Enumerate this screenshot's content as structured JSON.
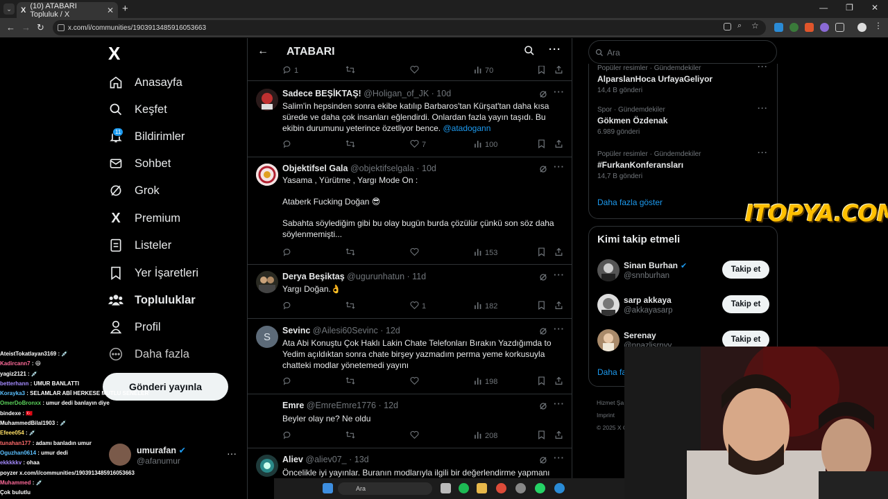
{
  "browser": {
    "tab_title": "(10) ATABARI Topluluk / X",
    "tab_logo": "X",
    "url": "x.com/i/communities/1903913485916053663",
    "new_tab_label": "+",
    "window_controls": [
      "—",
      "❐",
      "✕"
    ]
  },
  "nav": {
    "logo": "X",
    "items": [
      {
        "label": "Anasayfa",
        "icon": "home-icon"
      },
      {
        "label": "Keşfet",
        "icon": "search-icon"
      },
      {
        "label": "Bildirimler",
        "icon": "bell-icon"
      },
      {
        "label": "Sohbet",
        "icon": "mail-icon"
      },
      {
        "label": "Grok",
        "icon": "grok-icon"
      },
      {
        "label": "Premium",
        "icon": "x-icon"
      },
      {
        "label": "Listeler",
        "icon": "list-icon"
      },
      {
        "label": "Yer İşaretleri",
        "icon": "bookmark-icon"
      },
      {
        "label": "Topluluklar",
        "icon": "communities-icon"
      },
      {
        "label": "Profil",
        "icon": "profile-icon"
      },
      {
        "label": "Daha fazla",
        "icon": "more-circle-icon"
      }
    ],
    "notification_badge": "11",
    "post_button": "Gönderi yayınla",
    "account": {
      "name": "umurafan",
      "handle": "@afanumur",
      "more": "···"
    }
  },
  "chat": [
    {
      "user": "AteistTokatlayan3169",
      "color": "#ffffff",
      "msg": ": 💉"
    },
    {
      "user": "Kadircann7",
      "color": "#ff6b9a",
      "msg": ": 😆"
    },
    {
      "user": "yagiz2121",
      "color": "#ffffff",
      "msg": ": 💉"
    },
    {
      "user": "betterhann",
      "color": "#a58bff",
      "msg": ": UMUR BANLATTI"
    },
    {
      "user": "Korayka3",
      "color": "#5bc0ff",
      "msg": ": SELAMLAR ABİ HERKESE MUTLU SENELER"
    },
    {
      "user": "OmerDoBronxx",
      "color": "#5bd35b",
      "msg": ": umur dedi banlayın diye"
    },
    {
      "user": "bindexe",
      "color": "#ffffff",
      "msg": ": 🇹🇷"
    },
    {
      "user": "MuhammedBilal1903",
      "color": "#ffffff",
      "msg": ": 💉"
    },
    {
      "user": "Efeee054",
      "color": "#ffe066",
      "msg": ": 💉"
    },
    {
      "user": "tunahan177",
      "color": "#ff6b6b",
      "msg": ": adamı banladın umur"
    },
    {
      "user": "Oguzhan0614",
      "color": "#5bc0ff",
      "msg": ": umur dedi"
    },
    {
      "user": "ekkkkkv",
      "color": "#a58bff",
      "msg": ": ohaa"
    },
    {
      "user": "poyzer",
      "color": "#ffffff",
      "msg": "x.com/i/communities/1903913485916053663"
    },
    {
      "user": "Muhammed",
      "color": "#ff6b9a",
      "msg": ": 💉"
    },
    {
      "user": "",
      "color": "#cccccc",
      "msg": "Çok bulutlu"
    }
  ],
  "main": {
    "title": "ATABARI",
    "tweets": [
      {
        "name": "",
        "handle": "",
        "time": "",
        "text": "",
        "stats": {
          "reply": "1",
          "retweet": "",
          "like": "",
          "views": "70"
        }
      },
      {
        "name": "Sadece BEŞİKTAŞ!",
        "handle": "@Holigan_of_JK",
        "time": "· 10d",
        "text": "Salim'in hepsinden sonra ekibe katılıp Barbaros'tan Kürşat'tan daha kısa sürede ve daha çok insanları eğlendirdi. Onlardan fazla yayın taşıdı. Bu ekibin durumunu yeterince özetliyor bence. ",
        "mention": "@atadogann",
        "stats": {
          "reply": "",
          "retweet": "",
          "like": "7",
          "views": "100"
        }
      },
      {
        "name": "Objektifsel Gala",
        "handle": "@objektifselgala",
        "time": "· 10d",
        "text": "Yasama , Yürütme , Yargı Mode On :\n\nAtaberk Fucking Doğan 😎\n\nSabahta söylediğim gibi bu olay bugün burda çözülür çünkü son söz daha söylenmemişti...",
        "mention": "",
        "stats": {
          "reply": "",
          "retweet": "",
          "like": "",
          "views": "153"
        }
      },
      {
        "name": "Derya Beşiktaş",
        "handle": "@ugurunhatun",
        "time": "· 11d",
        "text": "Yargı Doğan.👌",
        "mention": "",
        "stats": {
          "reply": "",
          "retweet": "",
          "like": "1",
          "views": "182"
        }
      },
      {
        "name": "Sevinc",
        "handle": "@Ailesi60Sevinc",
        "time": "· 12d",
        "text": "Ata Abi Konuştu Çok Haklı Lakin Chate Telefonları Bırakın Yazdığımda to Yedim açıldıktan sonra chate birşey yazmadım perma yeme korkusuyla chatteki modlar yönetemedi yayını",
        "mention": "",
        "stats": {
          "reply": "",
          "retweet": "",
          "like": "",
          "views": "198"
        }
      },
      {
        "name": "Emre",
        "handle": "@EmreEmre1776",
        "time": "· 12d",
        "text": "Beyler olay ne? Ne oldu",
        "mention": "",
        "stats": {
          "reply": "",
          "retweet": "",
          "like": "",
          "views": "208"
        }
      },
      {
        "name": "Aliev",
        "handle": "@aliev07_",
        "time": "· 13d",
        "text": "Öncelikle iyi yayınlar. Buranın modlarıyla ilgili bir değerlendirme yapmanı",
        "mention": "",
        "stats": {
          "reply": "",
          "retweet": "",
          "like": "",
          "views": ""
        }
      }
    ]
  },
  "right": {
    "search_placeholder": "Ara",
    "trends": [
      {
        "context": "Popüler resimler · Gündemdekiler",
        "title": "AlparslanHoca UrfayaGeliyor",
        "count": "14,4 B gönderi"
      },
      {
        "context": "Spor · Gündemdekiler",
        "title": "Gökmen Özdenak",
        "count": "6.989 gönderi"
      },
      {
        "context": "Popüler resimler · Gündemdekiler",
        "title": "#FurkanKonferansları",
        "count": "14,7 B gönderi"
      }
    ],
    "show_more": "Daha fazla göster",
    "who_to_follow_title": "Kimi takip etmeli",
    "follow": [
      {
        "name": "Sinan Burhan",
        "handle": "@snnburhan",
        "verified": true,
        "button": "Takip et"
      },
      {
        "name": "sarp akkaya",
        "handle": "@akkayasarp",
        "verified": false,
        "button": "Takip et"
      },
      {
        "name": "Serenay",
        "handle": "@nnazlisrnyy",
        "verified": false,
        "button": "Takip et"
      }
    ],
    "who_more": "Daha fa",
    "footer": [
      "Hizmet Şa",
      "Imprint",
      "© 2025 X C"
    ]
  },
  "watermark": "ITOPYA.COM",
  "taskbar": {
    "search": "Ara"
  },
  "colors": {
    "accent": "#1d9bf0",
    "text": "#e7e9ea",
    "muted": "#71767b",
    "border": "#2f3336"
  }
}
